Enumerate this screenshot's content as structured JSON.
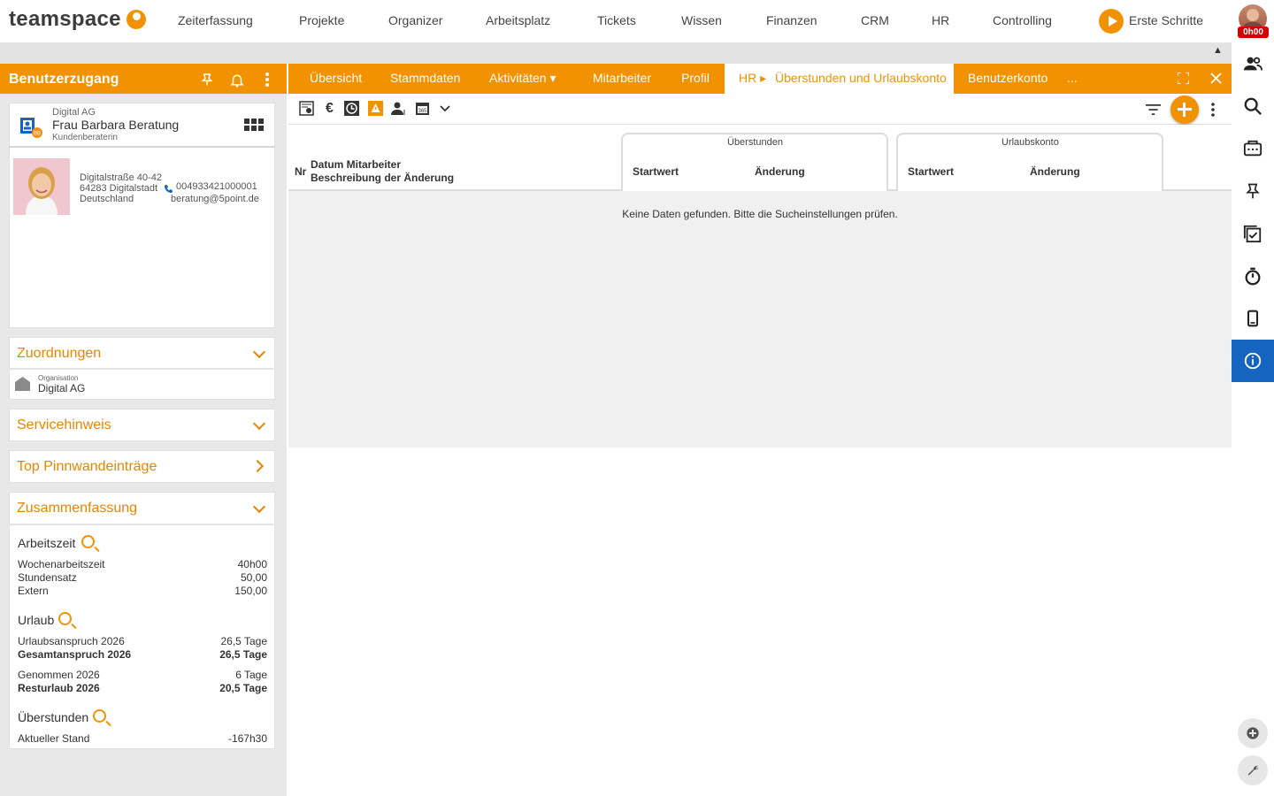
{
  "brand": {
    "name": "teamspace",
    "accent": "#f39200",
    "active_blue": "#1565c0"
  },
  "topnav": {
    "items": [
      "Zeiterfassung",
      "Projekte",
      "Organizer",
      "Arbeitsplatz",
      "Tickets",
      "Wissen",
      "Finanzen",
      "CRM",
      "HR",
      "Controlling"
    ],
    "first_steps": "Erste Schritte",
    "time_badge": "0h00"
  },
  "left": {
    "title": "Benutzerzugang",
    "contact": {
      "company": "Digital AG",
      "name": "Frau Barbara Beratung",
      "role": "Kundenberaterin",
      "street": "Digitalstraße 40-42",
      "city": "64283 Digitalstadt",
      "country": "Deutschland",
      "phone": "004933421000001",
      "email": "beratung@5point.de"
    },
    "zuordnungen": {
      "title": "Zuordnungen",
      "org_label": "Organisation",
      "org_value": "Digital AG"
    },
    "servicehinweis": {
      "title": "Servicehinweis"
    },
    "top_pinnwand": {
      "title": "Top Pinnwandeinträge"
    },
    "summary": {
      "title": "Zusammenfassung",
      "arbeitszeit": {
        "title": "Arbeitszeit",
        "rows": [
          {
            "label": "Wochenarbeitszeit",
            "value": "40h00"
          },
          {
            "label": "Stundensatz",
            "value": "50,00"
          },
          {
            "label": "Extern",
            "value": "150,00"
          }
        ]
      },
      "urlaub": {
        "title": "Urlaub",
        "rows": [
          {
            "label": "Urlaubsanspruch 2026",
            "value": "26,5 Tage"
          },
          {
            "label": "Gesamtanspruch 2026",
            "value": "26,5 Tage"
          },
          {
            "label": "Genommen 2026",
            "value": "6 Tage"
          },
          {
            "label": "Resturlaub 2026",
            "value": "20,5 Tage"
          }
        ]
      },
      "ueberstunden": {
        "title": "Überstunden",
        "rows": [
          {
            "label": "Aktueller Stand",
            "value": "-167h30"
          }
        ]
      }
    }
  },
  "tabs": {
    "items": [
      "Übersicht",
      "Stammdaten",
      "Aktivitäten ▾",
      "Mitarbeiter",
      "Profil"
    ],
    "active_prefix": "HR ▸",
    "active": "Überstunden und Urlaubskonto",
    "after": "Benutzerkonto",
    "more": "..."
  },
  "table": {
    "col_nr": "Nr",
    "col_datum": "Datum Mitarbeiter",
    "col_desc": "Beschreibung der Änderung",
    "group_ueberstunden": "Überstunden",
    "group_urlaub": "Urlaubskonto",
    "startwert": "Startwert",
    "aenderung": "Änderung",
    "empty": "Keine Daten gefunden. Bitte die Sucheinstellungen prüfen."
  }
}
